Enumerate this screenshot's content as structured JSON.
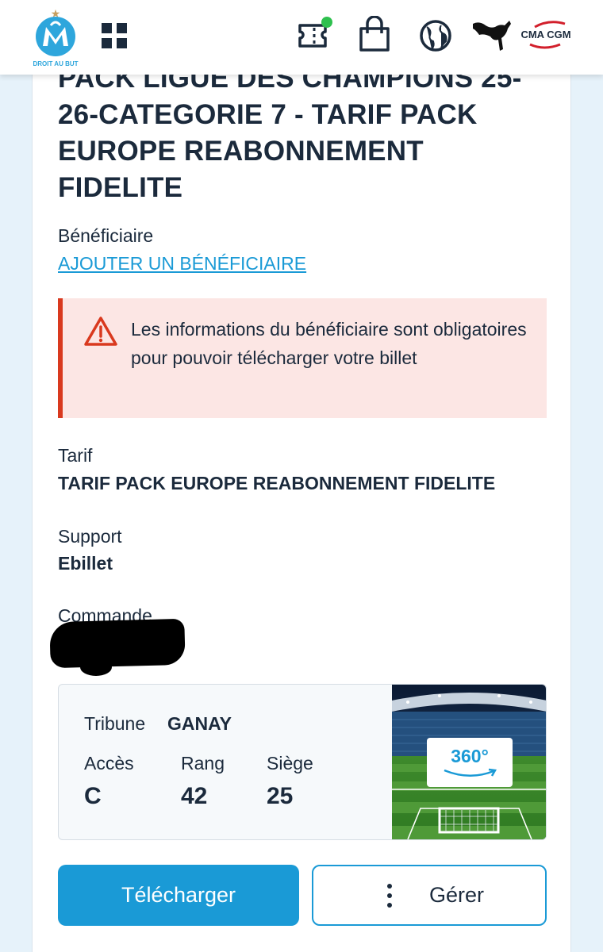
{
  "header": {
    "logo_motto": "DROIT AU BUT",
    "sponsor_brand": "CMA CGM",
    "icons": [
      "menu-grid-icon",
      "ticket-icon",
      "shopping-bag-icon",
      "globe-icon",
      "puma-icon"
    ],
    "notification_color": "#2ec04e"
  },
  "ticket": {
    "title": "PACK LIGUE DES CHAMPIONS 25-26-CATEGORIE 7 - TARIF PACK EUROPE REABONNEMENT FIDELITE",
    "beneficiary_label": "Bénéficiaire",
    "add_beneficiary_link": "AJOUTER UN BÉNÉFICIAIRE",
    "alert_message": "Les informations du bénéficiaire sont obligatoires pour pouvoir télécharger votre billet",
    "tarif_label": "Tarif",
    "tarif_value": "TARIF PACK EUROPE REABONNEMENT FIDELITE",
    "support_label": "Support",
    "support_value": "Ebillet",
    "order_label": "Commande"
  },
  "seat": {
    "tribune_label": "Tribune",
    "tribune_value": "GANAY",
    "access_label": "Accès",
    "access_value": "C",
    "row_label": "Rang",
    "row_value": "42",
    "seat_label": "Siège",
    "seat_value": "25",
    "view_badge": "360°"
  },
  "actions": {
    "download_label": "Télécharger",
    "manage_label": "Gérer"
  },
  "colors": {
    "accent": "#1a9ad6",
    "alert_bg": "#fce6e4",
    "alert_border": "#d9391e",
    "text": "#1b2a3c"
  }
}
